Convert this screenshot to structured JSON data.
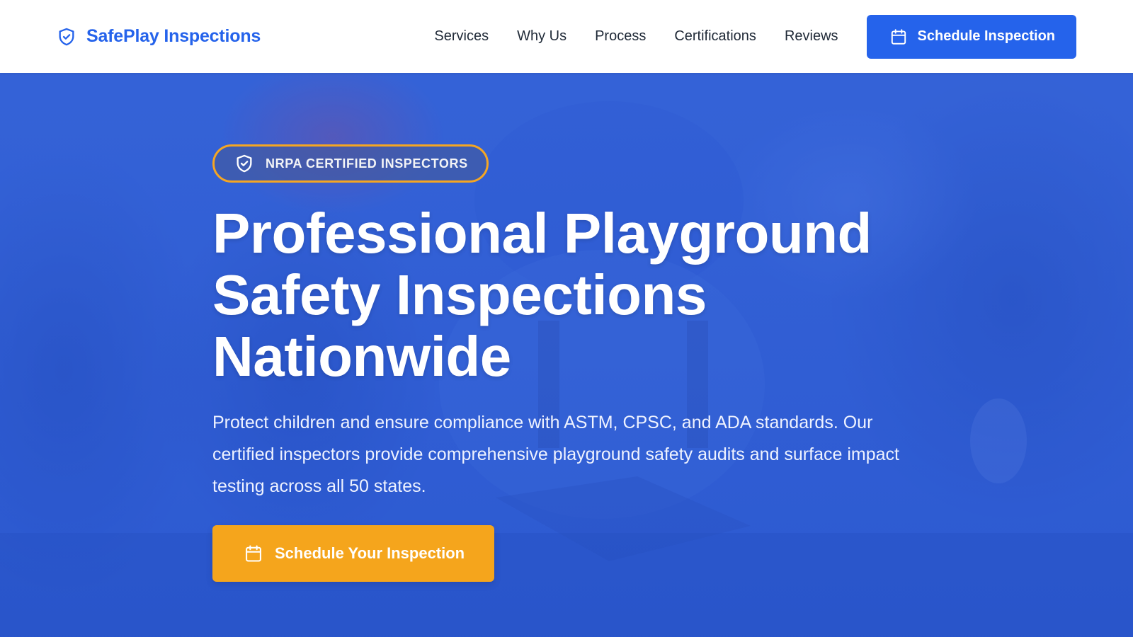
{
  "brand": {
    "name": "SafePlay Inspections",
    "logo_icon": "shield-check-icon",
    "color": "#2563eb"
  },
  "nav": {
    "links": [
      "Services",
      "Why Us",
      "Process",
      "Certifications",
      "Reviews"
    ],
    "cta_label": "Schedule Inspection",
    "cta_icon": "calendar-icon"
  },
  "hero": {
    "badge": {
      "text": "NRPA CERTIFIED INSPECTORS",
      "icon": "shield-check-icon",
      "border_color": "#f5a623"
    },
    "title_lines": [
      "Professional Playground",
      "Safety Inspections",
      "Nationwide"
    ],
    "description": "Protect children and ensure compliance with ASTM, CPSC, and ADA standards. Our certified inspectors provide comprehensive playground safety audits and surface impact testing across all 50 states.",
    "cta_label": "Schedule Your Inspection",
    "cta_icon": "calendar-icon",
    "cta_color": "#f5a51c",
    "overlay_color": "#2f5fd6"
  }
}
